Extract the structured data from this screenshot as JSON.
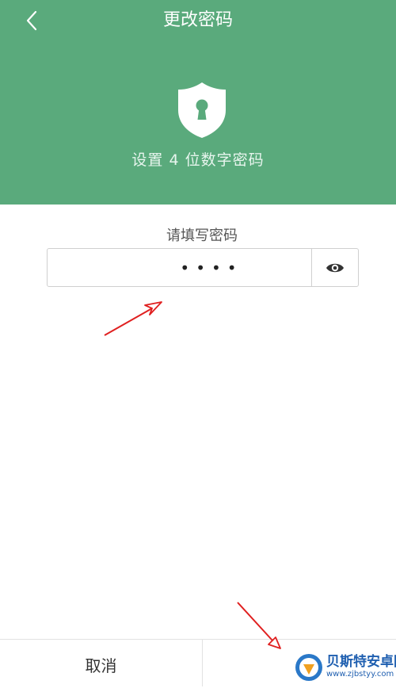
{
  "theme": {
    "brand_color": "#5aaa7c"
  },
  "header": {
    "title": "更改密码",
    "back_icon": "chevron-left-icon",
    "shield_icon": "shield-keyhole-icon",
    "subtitle": "设置 4 位数字密码"
  },
  "form": {
    "label": "请填写密码",
    "password_mask": "••••",
    "toggle_icon": "eye-icon"
  },
  "footer": {
    "cancel_label": "取消"
  },
  "watermark": {
    "name": "贝斯特安卓网",
    "url": "www.zjbstyy.com"
  }
}
